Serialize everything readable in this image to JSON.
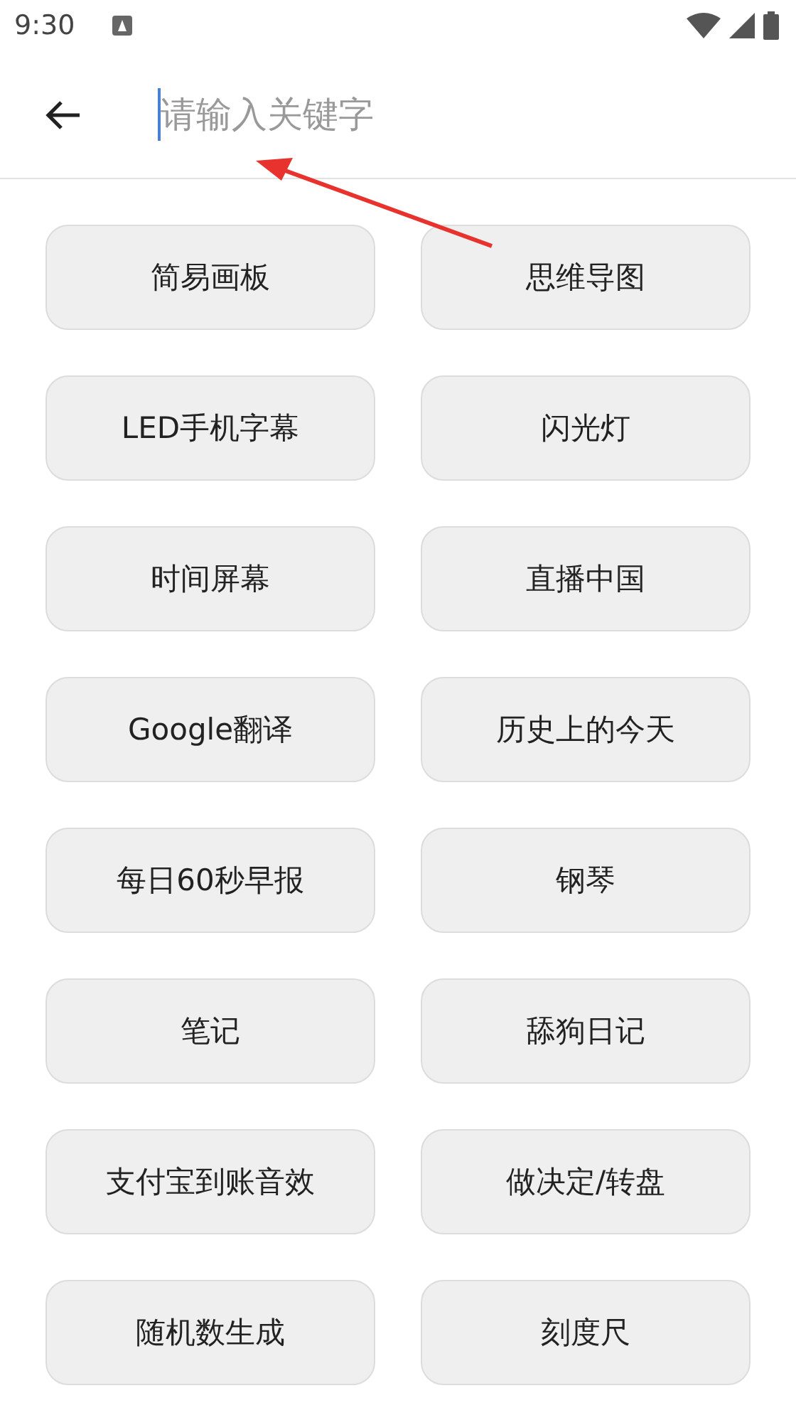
{
  "status_bar": {
    "time": "9:30"
  },
  "search": {
    "placeholder": "请输入关键字"
  },
  "tools": [
    {
      "label": "简易画板"
    },
    {
      "label": "思维导图"
    },
    {
      "label": "LED手机字幕"
    },
    {
      "label": "闪光灯"
    },
    {
      "label": "时间屏幕"
    },
    {
      "label": "直播中国"
    },
    {
      "label": "Google翻译"
    },
    {
      "label": "历史上的今天"
    },
    {
      "label": "每日60秒早报"
    },
    {
      "label": "钢琴"
    },
    {
      "label": "笔记"
    },
    {
      "label": "舔狗日记"
    },
    {
      "label": "支付宝到账音效"
    },
    {
      "label": "做决定/转盘"
    },
    {
      "label": "随机数生成"
    },
    {
      "label": "刻度尺"
    }
  ]
}
